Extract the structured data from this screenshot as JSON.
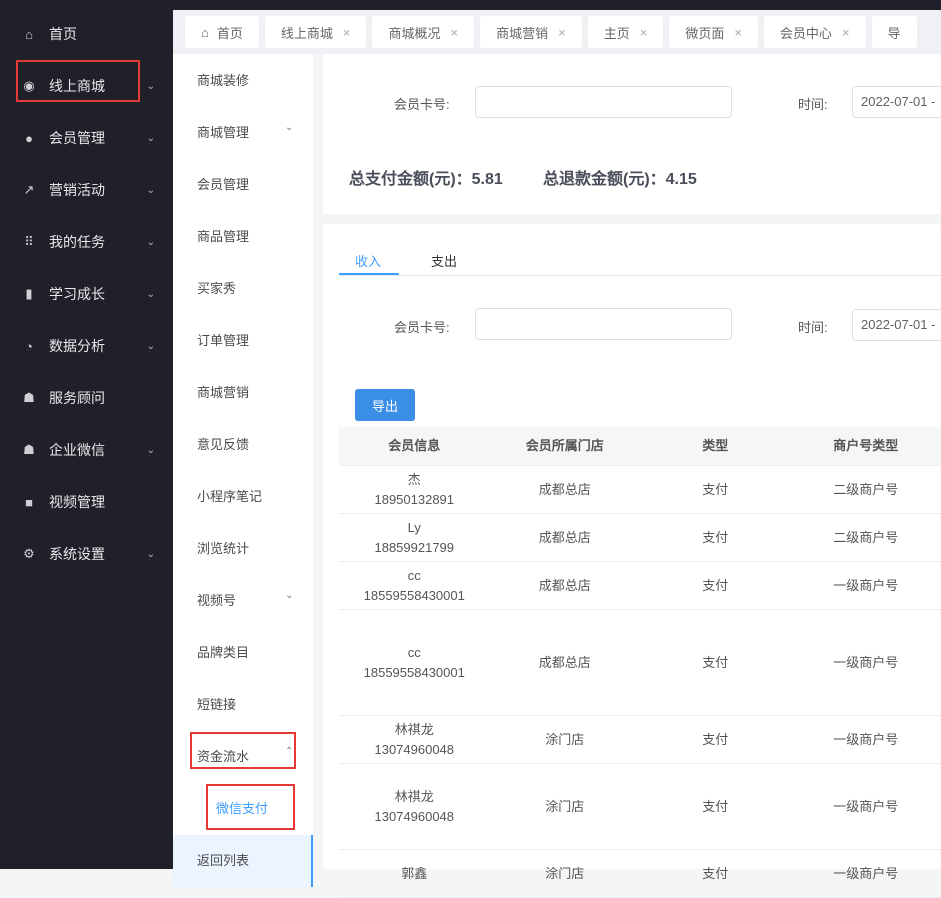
{
  "sidebar": {
    "items": [
      {
        "label": "首页",
        "icon": "home-icon",
        "glyph": "⌂"
      },
      {
        "label": "线上商城",
        "icon": "shop-icon",
        "glyph": "◉",
        "chev": "⌄"
      },
      {
        "label": "会员管理",
        "icon": "user-icon",
        "glyph": "●",
        "chev": "⌄"
      },
      {
        "label": "营销活动",
        "icon": "trend-icon",
        "glyph": "↗",
        "chev": "⌄"
      },
      {
        "label": "我的任务",
        "icon": "grid-icon",
        "glyph": "⠿",
        "chev": "⌄"
      },
      {
        "label": "学习成长",
        "icon": "book-icon",
        "glyph": "▮",
        "chev": "⌄"
      },
      {
        "label": "数据分析",
        "icon": "pie-icon",
        "glyph": "◔",
        "chev": "⌄"
      },
      {
        "label": "服务顾问",
        "icon": "team-icon",
        "glyph": "☗"
      },
      {
        "label": "企业微信",
        "icon": "team-icon",
        "glyph": "☗",
        "chev": "⌄"
      },
      {
        "label": "视频管理",
        "icon": "video-icon",
        "glyph": "■"
      },
      {
        "label": "系统设置",
        "icon": "gear-icon",
        "glyph": "⚙",
        "chev": "⌄"
      }
    ]
  },
  "tabs": [
    {
      "label": "首页",
      "home": "⌂"
    },
    {
      "label": "线上商城",
      "close": "×"
    },
    {
      "label": "商城概况",
      "close": "×"
    },
    {
      "label": "商城营销",
      "close": "×"
    },
    {
      "label": "主页",
      "close": "×"
    },
    {
      "label": "微页面",
      "close": "×"
    },
    {
      "label": "会员中心",
      "close": "×"
    },
    {
      "label": "导"
    }
  ],
  "submenu": [
    {
      "label": "商城装修"
    },
    {
      "label": "商城管理",
      "chev": "⌄"
    },
    {
      "label": "会员管理"
    },
    {
      "label": "商品管理"
    },
    {
      "label": "买家秀"
    },
    {
      "label": "订单管理"
    },
    {
      "label": "商城营销"
    },
    {
      "label": "意见反馈"
    },
    {
      "label": "小程序笔记"
    },
    {
      "label": "浏览统计"
    },
    {
      "label": "视频号",
      "chev": "⌄"
    },
    {
      "label": "品牌类目"
    },
    {
      "label": "短链接"
    },
    {
      "label": "资金流水",
      "chev": "⌃"
    },
    {
      "label": "微信支付"
    },
    {
      "label": "返回列表"
    }
  ],
  "filter": {
    "card_label": "会员卡号:",
    "card_value": "",
    "time_label": "时间:",
    "time_value": "2022-07-01 -"
  },
  "totals": {
    "pay": "总支付金额(元)：5.81",
    "refund": "总退款金额(元)：4.15"
  },
  "panel": {
    "tabs": [
      "收入",
      "支出"
    ],
    "card_label": "会员卡号:",
    "card_value": "",
    "time_label": "时间:",
    "time_value": "2022-07-01 -",
    "export": "导出"
  },
  "table": {
    "headers": [
      "会员信息",
      "会员所属门店",
      "类型",
      "商户号类型"
    ],
    "rows": [
      [
        "杰",
        "18950132891",
        "成都总店",
        "支付",
        "二级商户号"
      ],
      [
        "Ly",
        "18859921799",
        "成都总店",
        "支付",
        "二级商户号"
      ],
      [
        "cc",
        "18559558430001",
        "成都总店",
        "支付",
        "一级商户号"
      ],
      [
        "cc",
        "18559558430001",
        "成都总店",
        "支付",
        "一级商户号"
      ],
      [
        "林祺龙",
        "13074960048",
        "涂门店",
        "支付",
        "一级商户号"
      ],
      [
        "林祺龙",
        "13074960048",
        "涂门店",
        "支付",
        "一级商户号"
      ],
      [
        "郭鑫",
        "",
        "涂门店",
        "支付",
        "一级商户号"
      ]
    ]
  }
}
